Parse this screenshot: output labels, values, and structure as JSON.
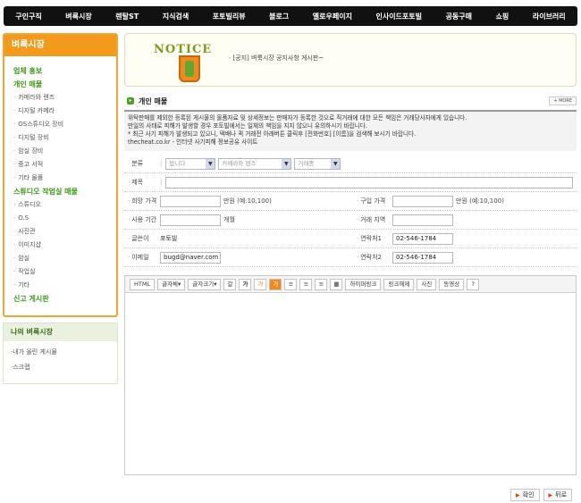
{
  "topnav": [
    "구인구직",
    "벼룩시장",
    "렌탈ST",
    "지식검색",
    "포토빌리뷰",
    "블로그",
    "옐로우페이지",
    "인사이드포토빌",
    "공동구매",
    "쇼핑",
    "라이브러리"
  ],
  "sidebar": {
    "title": "벼룩시장",
    "items": [
      {
        "type": "cat",
        "label": "업체 홍보"
      },
      {
        "type": "cat",
        "label": "개인 매물"
      },
      {
        "type": "sub",
        "label": "카메라와 렌즈"
      },
      {
        "type": "sub",
        "label": "디지털 카메라"
      },
      {
        "type": "sub",
        "label": "OS스튜디오 장비"
      },
      {
        "type": "sub",
        "label": "디지털 장비"
      },
      {
        "type": "sub",
        "label": "암실 장비"
      },
      {
        "type": "sub",
        "label": "중고 서적"
      },
      {
        "type": "sub",
        "label": "기타 물품"
      },
      {
        "type": "cat",
        "label": "스튜디오 작업실 매물"
      },
      {
        "type": "sub",
        "label": "스튜디오"
      },
      {
        "type": "sub",
        "label": "O.S"
      },
      {
        "type": "sub",
        "label": "사진관"
      },
      {
        "type": "sub",
        "label": "이미지샵"
      },
      {
        "type": "sub",
        "label": "암실"
      },
      {
        "type": "sub",
        "label": "작업실"
      },
      {
        "type": "sub",
        "label": "기타"
      },
      {
        "type": "cat",
        "label": "신고 게시판"
      }
    ],
    "my_title": "나의 벼룩시장",
    "my_items": [
      "내가 올린 게시물",
      "스크랩"
    ]
  },
  "notice": {
    "logo_word": "NOTICE",
    "text": "· [공지] 벼룩시장 공지사항 게시판~"
  },
  "section": {
    "title": "개인 매물",
    "more": "+ MORE"
  },
  "info_lines": [
    "위탁판매를 제외한 등록된 게시물의 물품자료 및 상세정보는 판매자가 등록한 것으로 직거래에 대한 모든 책임은 거래당사자에게 있습니다.",
    "만일의 사태로 피해가 발생할 경우 포토빌에서는 일체의 책임을 지지 않으니 유의하시기 바랍니다.",
    "* 최근 사기 피해가 발생되고 있으니, 택배나 퀵 거래전 아래버튼 클릭후 [전화번호] [이름]을 검색해 보시기 바랍니다.",
    "thecheat.co.kr - 인터넷 사기피해 정보공유 사이트"
  ],
  "form": {
    "category_label": "분류",
    "category_values": [
      "팝니다",
      "카메라와 렌즈",
      "거래중"
    ],
    "title_label": "제목",
    "hope_price_label": "희망 가격",
    "hope_price_unit": "만원 (예:10,100)",
    "buy_price_label": "구입 가격",
    "buy_price_unit": "만원 (예:10,100)",
    "use_period_label": "사용 기간",
    "use_period_unit": "개월",
    "trade_area_label": "거래 지역",
    "writer_label": "글쓴이",
    "writer_value": "포토빌",
    "contact1_label": "연락처1",
    "contact1_value": "02-546-1784",
    "email_label": "이메일",
    "email_value": "bugd@naver.com",
    "contact2_label": "연락처2",
    "contact2_value": "02-546-1784"
  },
  "editor": {
    "toolbar": [
      "HTML",
      "글자체▾",
      "글자크기▾",
      "갈",
      "가",
      "가",
      "가",
      "하이퍼링크",
      "링크해제",
      "사진",
      "동영상",
      "?"
    ]
  },
  "buttons": {
    "confirm": "확인",
    "back": "뒤로"
  }
}
